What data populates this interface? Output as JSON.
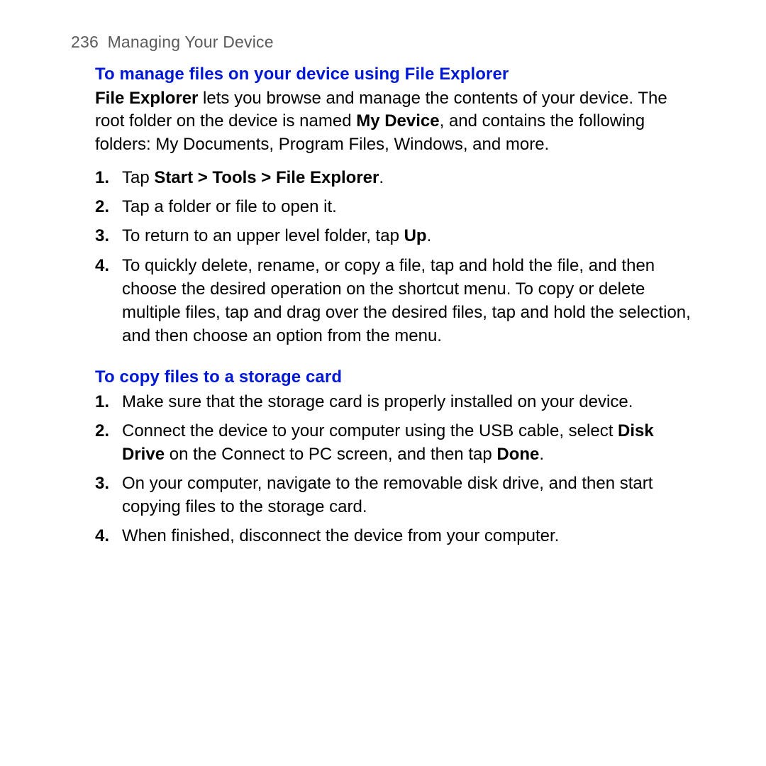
{
  "header": {
    "page_number": "236",
    "title": "Managing Your Device"
  },
  "sections": [
    {
      "subtitle": "To manage files on your device using File Explorer",
      "intro_parts": [
        {
          "text": "File Explorer",
          "bold": true
        },
        {
          "text": " lets you browse and manage the contents of your device. The root folder on the device is named "
        },
        {
          "text": "My Device",
          "bold": true
        },
        {
          "text": ", and contains the following folders: My Documents, Program Files, Windows, and more."
        }
      ],
      "steps": [
        [
          {
            "text": "Tap "
          },
          {
            "text": "Start > Tools > File Explorer",
            "bold": true
          },
          {
            "text": "."
          }
        ],
        [
          {
            "text": "Tap a folder or file to open it."
          }
        ],
        [
          {
            "text": "To return to an upper level folder, tap "
          },
          {
            "text": "Up",
            "bold": true
          },
          {
            "text": "."
          }
        ],
        [
          {
            "text": "To quickly delete, rename, or copy a file, tap and hold the file, and then choose the desired operation on the shortcut menu. To copy or delete multiple files, tap and drag over the desired files, tap and hold the selection, and then choose an option from the menu."
          }
        ]
      ]
    },
    {
      "subtitle": "To copy files to a storage card",
      "intro_parts": [],
      "steps": [
        [
          {
            "text": "Make sure that the storage card is properly installed on your device."
          }
        ],
        [
          {
            "text": "Connect the device to your computer using the USB cable, select "
          },
          {
            "text": "Disk Drive",
            "bold": true
          },
          {
            "text": " on the Connect to PC screen, and then tap "
          },
          {
            "text": "Done",
            "bold": true
          },
          {
            "text": "."
          }
        ],
        [
          {
            "text": "On your computer, navigate to the removable disk drive, and then start copying files to the storage card."
          }
        ],
        [
          {
            "text": "When finished, disconnect the device from your computer."
          }
        ]
      ]
    }
  ]
}
